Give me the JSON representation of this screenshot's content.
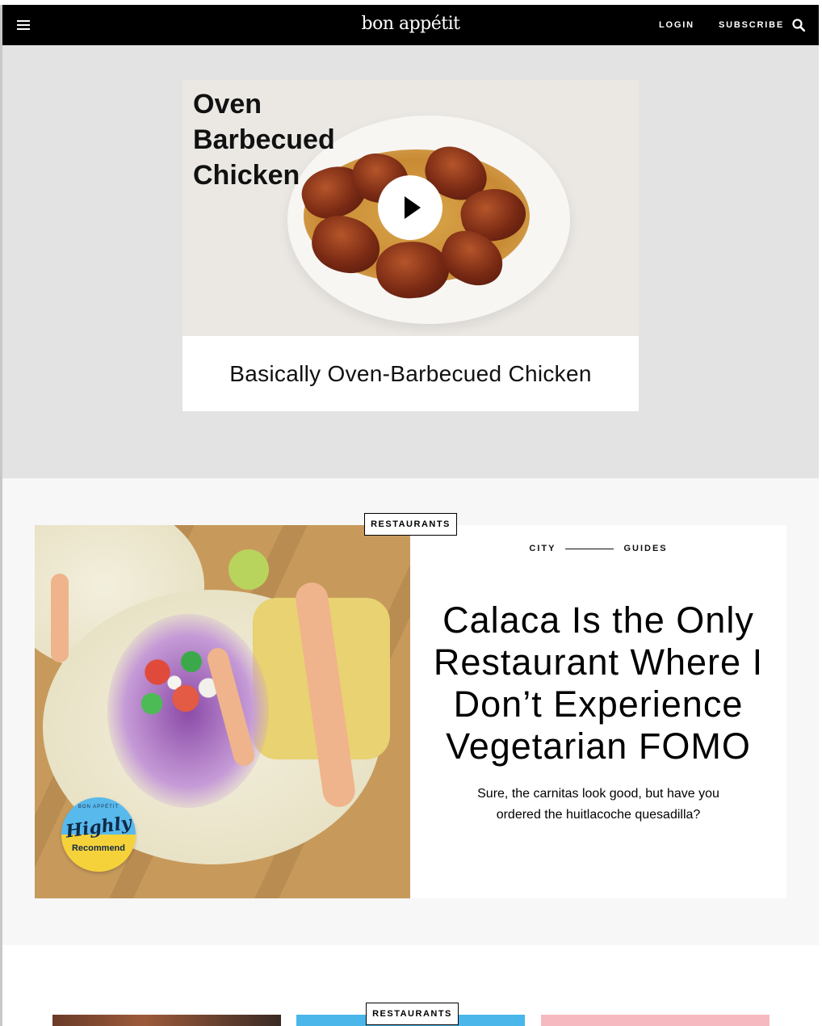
{
  "header": {
    "logo": "bon appétit",
    "login_label": "LOGIN",
    "subscribe_label": "SUBSCRIBE",
    "menu_icon": "hamburger-menu-icon",
    "search_icon": "search-icon"
  },
  "hero": {
    "video_title_lines": [
      "Oven",
      "Barbecued",
      "Chicken"
    ],
    "caption": "Basically Oven-Barbecued Chicken",
    "play_icon": "play-icon"
  },
  "feature": {
    "tag": "RESTAURANTS",
    "rubric_left": "CITY",
    "rubric_right": "GUIDES",
    "headline": "Calaca Is the Only Restaurant Where I Don’t Experience Vegetarian FOMO",
    "dek": "Sure, the carnitas look good, but have you ordered the huitlacoche quesadilla?",
    "badge": {
      "top": "BON APPÉTIT",
      "script": "Highly",
      "bottom": "Recommend"
    }
  },
  "bottom": {
    "tag": "RESTAURANTS"
  },
  "colors": {
    "header_bg": "#000000",
    "hero_bg": "#e3e3e3",
    "feature_bg": "#f7f7f7",
    "badge_blue": "#58b9ec",
    "badge_yellow": "#f6d23a"
  }
}
